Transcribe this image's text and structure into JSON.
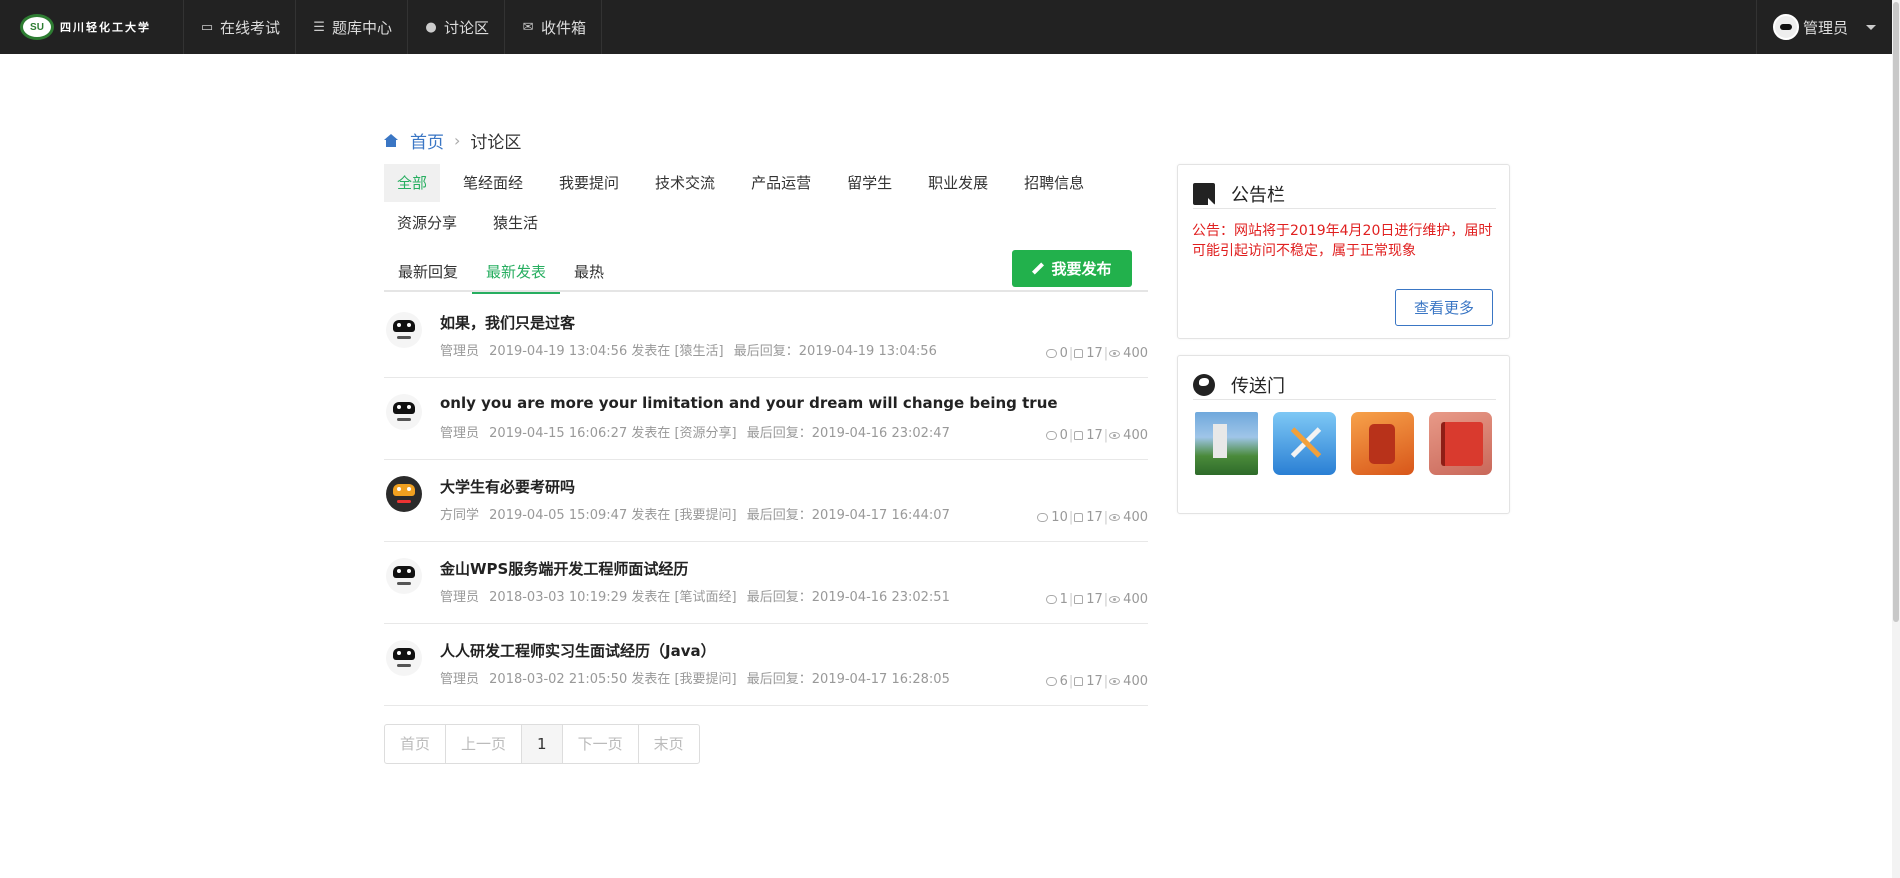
{
  "nav": {
    "logo_text": "四川轻化工大学",
    "items": [
      {
        "label": "在线考试",
        "icon": "monitor-icon"
      },
      {
        "label": "题库中心",
        "icon": "list-icon"
      },
      {
        "label": "讨论区",
        "icon": "comment-icon"
      },
      {
        "label": "收件箱",
        "icon": "envelope-icon"
      }
    ],
    "user": "管理员"
  },
  "breadcrumb": {
    "home": "首页",
    "current": "讨论区"
  },
  "categories": [
    "全部",
    "笔经面经",
    "我要提问",
    "技术交流",
    "产品运营",
    "留学生",
    "职业发展",
    "招聘信息",
    "资源分享",
    "猿生活"
  ],
  "active_category": "全部",
  "sort_tabs": [
    "最新回复",
    "最新发表",
    "最热"
  ],
  "active_sort": "最新发表",
  "publish_label": "我要发布",
  "posts": [
    {
      "title": "如果，我们只是过客",
      "author": "管理员",
      "posted": "2019-04-19 13:04:56 发表在 [猿生活]",
      "last_reply": "最后回复：2019-04-19 13:04:56",
      "comments": "0",
      "likes": "17",
      "views": "400",
      "avatar": "panda-avatar"
    },
    {
      "title": "only you are more your limitation and your dream will change being true",
      "author": "管理员",
      "posted": "2019-04-15 16:06:27 发表在 [资源分享]",
      "last_reply": "最后回复：2019-04-16 23:02:47",
      "comments": "0",
      "likes": "17",
      "views": "400",
      "avatar": "panda-avatar"
    },
    {
      "title": "大学生有必要考研吗",
      "author": "方同学",
      "posted": "2019-04-05 15:09:47 发表在 [我要提问]",
      "last_reply": "最后回复：2019-04-17 16:44:07",
      "comments": "10",
      "likes": "17",
      "views": "400",
      "avatar": "cartoon-avatar"
    },
    {
      "title": "金山WPS服务端开发工程师面试经历",
      "author": "管理员",
      "posted": "2018-03-03 10:19:29 发表在 [笔试面经]",
      "last_reply": "最后回复：2019-04-16 23:02:51",
      "comments": "1",
      "likes": "17",
      "views": "400",
      "avatar": "panda-avatar"
    },
    {
      "title": "人人研发工程师实习生面试经历（Java）",
      "author": "管理员",
      "posted": "2018-03-02 21:05:50 发表在 [我要提问]",
      "last_reply": "最后回复：2019-04-17 16:28:05",
      "comments": "6",
      "likes": "17",
      "views": "400",
      "avatar": "panda-avatar"
    }
  ],
  "pagination": {
    "first": "首页",
    "prev": "上一页",
    "current": "1",
    "next": "下一页",
    "last": "末页"
  },
  "notice_card": {
    "title": "公告栏",
    "text": "公告：网站将于2019年4月20日进行维护，届时可能引起访问不稳定，属于正常现象",
    "more": "查看更多"
  },
  "portal_card": {
    "title": "传送门",
    "links": [
      "campus-photo",
      "developer-tools-icon",
      "audio-app-icon",
      "notebook-icon"
    ]
  },
  "colors": {
    "accent": "#27ae60",
    "link": "#3a76c4",
    "notice": "#e02020",
    "navbar": "#222222"
  }
}
